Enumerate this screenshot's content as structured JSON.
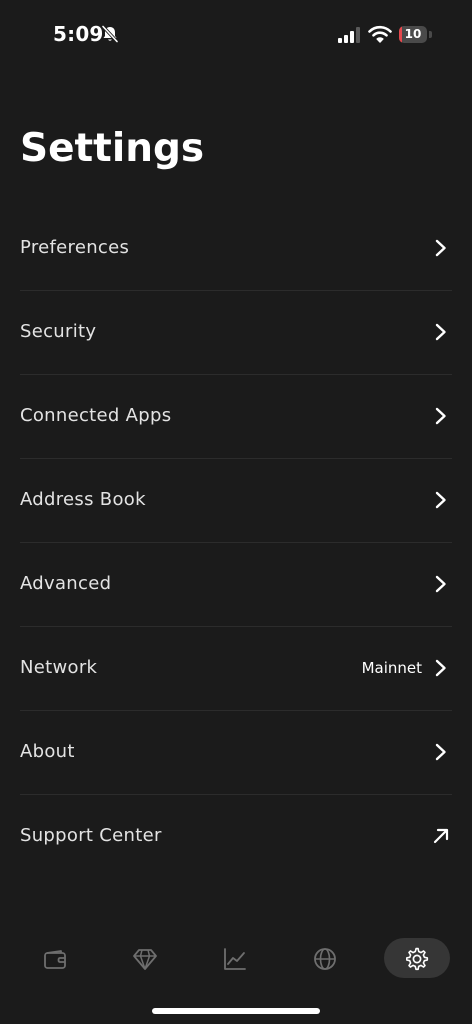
{
  "status_bar": {
    "time": "5:09",
    "battery_level": "10",
    "battery_fraction": 0.1,
    "icons": [
      "bell-slash-icon",
      "cellular-signal-icon",
      "wifi-icon",
      "battery-icon"
    ]
  },
  "page": {
    "title": "Settings"
  },
  "settings": [
    {
      "label": "Preferences",
      "trailing": "chevron"
    },
    {
      "label": "Security",
      "trailing": "chevron"
    },
    {
      "label": "Connected Apps",
      "trailing": "chevron"
    },
    {
      "label": "Address Book",
      "trailing": "chevron"
    },
    {
      "label": "Advanced",
      "trailing": "chevron"
    },
    {
      "label": "Network",
      "value": "Mainnet",
      "trailing": "chevron"
    },
    {
      "label": "About",
      "trailing": "chevron"
    },
    {
      "label": "Support Center",
      "trailing": "external-arrow"
    }
  ],
  "tab_bar": {
    "tabs": [
      {
        "icon": "wallet-icon",
        "active": false
      },
      {
        "icon": "diamond-icon",
        "active": false
      },
      {
        "icon": "chart-icon",
        "active": false
      },
      {
        "icon": "globe-icon",
        "active": false
      },
      {
        "icon": "gear-icon",
        "active": true
      }
    ]
  },
  "colors": {
    "background": "#1b1b1b",
    "text_primary": "#ffffff",
    "row_text": "#e3e3e3",
    "divider": "#2c2c2c",
    "tab_inactive": "#6e6e6e",
    "tab_active_bg": "#363636",
    "battery_low": "#e5484d"
  }
}
